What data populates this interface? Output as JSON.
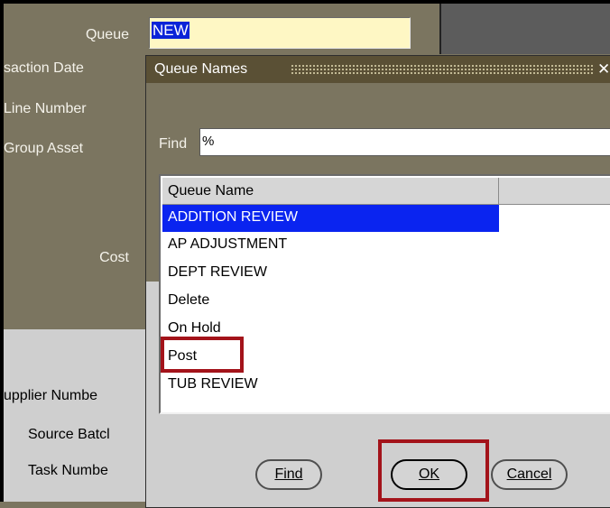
{
  "form": {
    "labels": {
      "queue": "Queue",
      "transaction_date": "saction Date",
      "line_number": "Line Number",
      "group_asset": "Group Asset",
      "cost": "Cost",
      "supplier_number": "upplier Numbe",
      "source_batch": "Source Batcl",
      "task_number": "Task Numbe"
    },
    "queue_value": "NEW"
  },
  "dialog": {
    "title": "Queue Names",
    "find_label": "Find",
    "find_value": "%",
    "column_header": "Queue Name",
    "items": [
      {
        "label": "ADDITION REVIEW",
        "selected": true
      },
      {
        "label": "AP ADJUSTMENT"
      },
      {
        "label": "DEPT REVIEW"
      },
      {
        "label": "Delete"
      },
      {
        "label": "On Hold"
      },
      {
        "label": "Post",
        "highlighted": true
      },
      {
        "label": "TUB REVIEW"
      }
    ],
    "buttons": {
      "find": "Find",
      "ok": "OK",
      "cancel": "Cancel"
    }
  },
  "colors": {
    "background_olive": "#7b7560",
    "titlebar": "#5a5035",
    "selection_blue": "#0a24f0",
    "highlight_red": "#a3131a",
    "field_yellow": "#fef7c4"
  }
}
